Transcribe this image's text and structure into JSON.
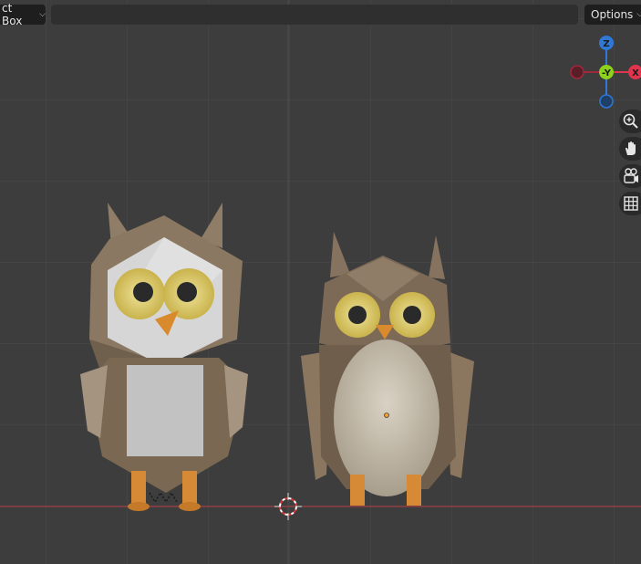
{
  "header": {
    "mode_label": "ct Box",
    "options_label": "Options"
  },
  "gizmo": {
    "z_label": "Z",
    "y_label": "-Y",
    "x_label": "X",
    "colors": {
      "x": "#e2344c",
      "y": "#8dd21c",
      "z": "#2f78d6",
      "neg": "#a1283a"
    }
  },
  "nav_tools": [
    "zoom-icon",
    "pan-hand-icon",
    "camera-view-icon",
    "ortho-grid-icon"
  ],
  "colors": {
    "background": "#3d3d3d",
    "grid_line": "#4a4a4a",
    "x_axis": "#b23a44"
  }
}
